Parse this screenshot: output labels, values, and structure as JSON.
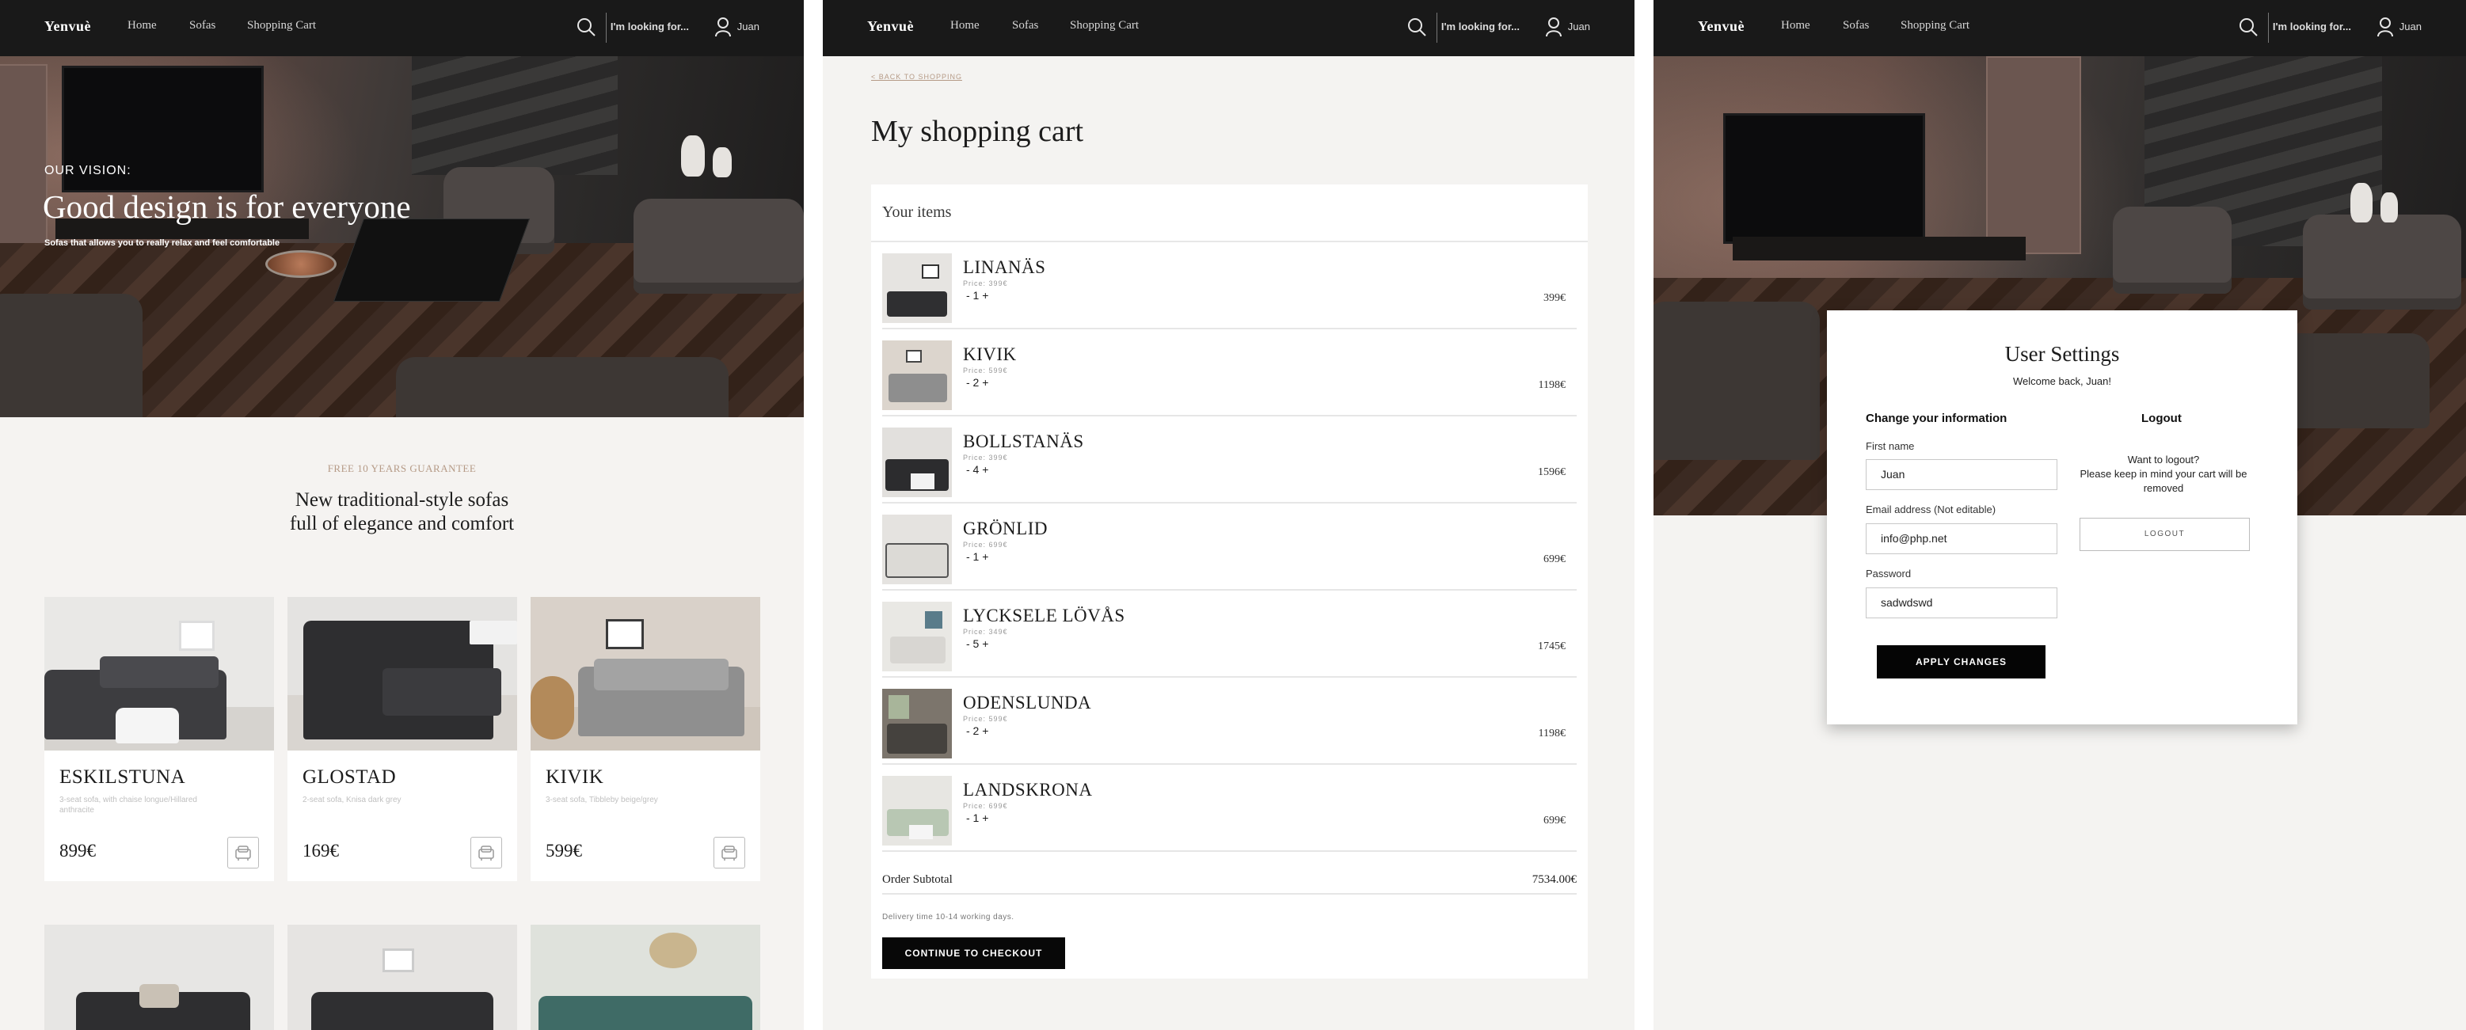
{
  "nav": {
    "logo": "Yenvuè",
    "links": [
      "Home",
      "Sofas",
      "Shopping Cart"
    ],
    "search_placeholder": "I'm looking for...",
    "user_name": "Juan"
  },
  "home": {
    "hero_kicker": "OUR VISION:",
    "hero_title": "Good design is for everyone",
    "hero_subtitle": "Sofas that allows you to really relax and feel comfortable",
    "guarantee": "FREE 10 YEARS GUARANTEE",
    "tagline_line1": "New traditional-style sofas",
    "tagline_line2": "full of elegance and comfort",
    "products": [
      {
        "name": "ESKILSTUNA",
        "desc": "3-seat sofa, with chaise longue/Hillared anthracite",
        "price": "899€"
      },
      {
        "name": "GLOSTAD",
        "desc": "2-seat sofa, Knisa dark grey",
        "price": "169€"
      },
      {
        "name": "KIVIK",
        "desc": "3-seat sofa, Tibbleby beige/grey",
        "price": "599€"
      }
    ]
  },
  "cart": {
    "back_link": "< BACK TO SHOPPING",
    "title": "My shopping cart",
    "items_header": "Your items",
    "items": [
      {
        "name": "LINANÄS",
        "unit_price": "Price: 399€",
        "qty": "- 1 +",
        "total": "399€"
      },
      {
        "name": "KIVIK",
        "unit_price": "Price: 599€",
        "qty": "- 2 +",
        "total": "1198€"
      },
      {
        "name": "BOLLSTANÄS",
        "unit_price": "Price: 399€",
        "qty": "- 4 +",
        "total": "1596€"
      },
      {
        "name": "GRÖNLID",
        "unit_price": "Price: 699€",
        "qty": "- 1 +",
        "total": "699€"
      },
      {
        "name": "LYCKSELE LÖVÅS",
        "unit_price": "Price: 349€",
        "qty": "- 5 +",
        "total": "1745€"
      },
      {
        "name": "ODENSLUNDA",
        "unit_price": "Price: 599€",
        "qty": "- 2 +",
        "total": "1198€"
      },
      {
        "name": "LANDSKRONA",
        "unit_price": "Price: 699€",
        "qty": "- 1 +",
        "total": "699€"
      }
    ],
    "subtotal_label": "Order Subtotal",
    "subtotal_value": "7534.00€",
    "delivery_note": "Delivery time 10-14 working days.",
    "checkout_label": "CONTINUE TO CHECKOUT"
  },
  "settings": {
    "title": "User Settings",
    "welcome": "Welcome back, Juan!",
    "change_info_heading": "Change your information",
    "first_name_label": "First name",
    "first_name_value": "Juan",
    "email_label": "Email address (Not editable)",
    "email_value": "info@php.net",
    "password_label": "Password",
    "password_value": "sadwdswd",
    "apply_label": "APPLY CHANGES",
    "logout_heading": "Logout",
    "logout_question": "Want to logout?",
    "logout_note": "Please keep in mind your cart will be removed",
    "logout_button": "LOGOUT"
  },
  "colors": {
    "nav_bg": "#191919",
    "page_bg": "#f5f3f1",
    "accent_tan": "#b59a86",
    "button_black": "#080808"
  },
  "icons": [
    "search-icon",
    "user-icon",
    "cart-add-icon"
  ]
}
